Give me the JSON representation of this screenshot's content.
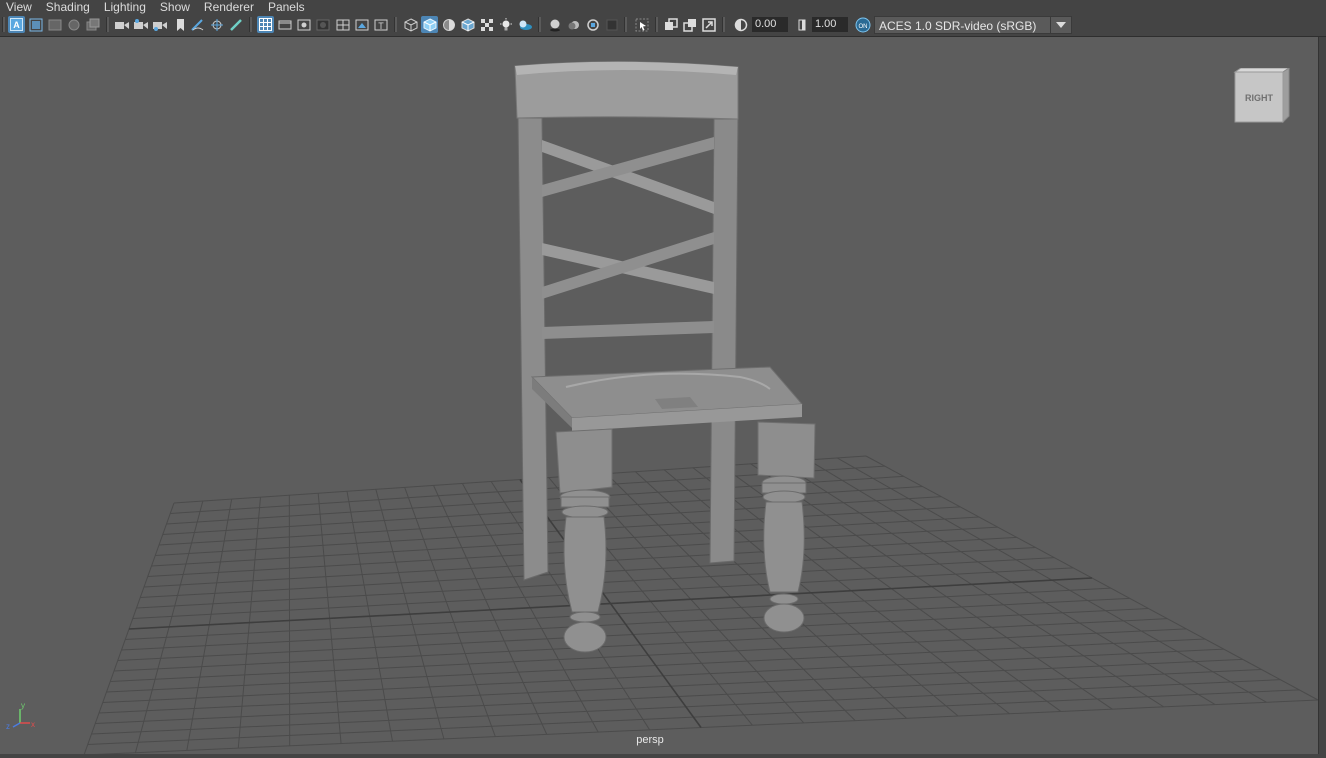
{
  "menubar": {
    "items": [
      "View",
      "Shading",
      "Lighting",
      "Show",
      "Renderer",
      "Panels"
    ]
  },
  "toolbar": {
    "exposure_value": "0.00",
    "gamma_value": "1.00",
    "color_space": "ACES 1.0 SDR-video (sRGB)",
    "color_mgmt_badge": "ON",
    "icons": [
      "select-camera-icon",
      "camera-attributes-icon",
      "bookmarks-icon",
      "image-plane-icon",
      "2d-pan-zoom-icon",
      "camera-icon",
      "lock-camera-icon",
      "track-camera-icon",
      "bookmark-icon",
      "grease-pencil-icon",
      "pencil-icon",
      "grid-icon",
      "film-gate-icon",
      "resolution-gate-icon",
      "gate-mask-icon",
      "field-chart-icon",
      "safe-action-icon",
      "safe-title-icon",
      "wireframe-icon",
      "smooth-shade-icon",
      "default-material-icon",
      "wireframe-on-shaded-icon",
      "textured-icon",
      "use-all-lights-icon",
      "shadows-icon",
      "screen-space-ao-icon",
      "motion-blur-icon",
      "anti-aliasing-icon",
      "depth-of-field-icon",
      "isolate-select-icon",
      "xray-icon",
      "xray-joints-icon",
      "xray-components-icon",
      "exposure-icon",
      "gamma-icon",
      "color-management-icon"
    ]
  },
  "viewport": {
    "camera_name": "persp",
    "viewcube_label": "RIGHT",
    "axis_labels": {
      "x": "x",
      "y": "y",
      "z": "z"
    }
  },
  "colors": {
    "accent": "#4d86b5",
    "viewport_bg": "#5d5d5d",
    "grid": "#4a4a4a",
    "model": "#8f8f8f"
  }
}
